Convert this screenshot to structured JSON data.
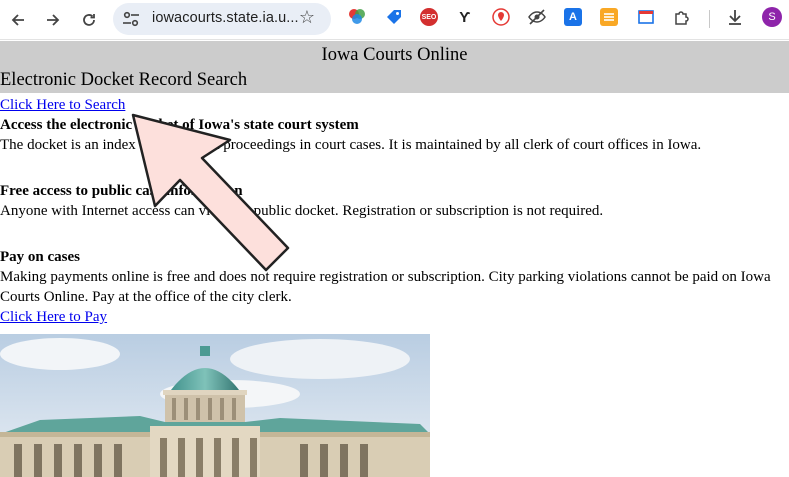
{
  "browser": {
    "url": "iowacourts.state.ia.u...",
    "avatar_initial": "S",
    "extensions": [
      "color-wheel-icon",
      "tag-icon",
      "seo-icon",
      "y-icon",
      "map-pin-icon",
      "eye-slash-icon",
      "translate-icon",
      "note-icon",
      "window-icon",
      "puzzle-icon"
    ],
    "seo_label": "SEO"
  },
  "page": {
    "site_title": "Iowa Courts Online",
    "subtitle": "Electronic Docket Record Search",
    "search_link": "Click Here to Search",
    "sections": [
      {
        "heading": "Access the electronic docket of Iowa's state court system",
        "body": "The docket is an index of filings and proceedings in court cases. It is maintained by all clerk of court offices in Iowa."
      },
      {
        "heading": "Free access to public case information",
        "body": "Anyone with Internet access can view the public docket. Registration or subscription is not required."
      },
      {
        "heading": "Pay on cases",
        "body": "Making payments online is free and does not require registration or subscription. City parking violations cannot be paid on Iowa Courts Online. Pay at the office of the city clerk."
      }
    ],
    "pay_link": "Click Here to Pay"
  },
  "colors": {
    "header_band": "#cccccc",
    "link": "#0000ee",
    "arrow_fill": "#fde0dc",
    "arrow_stroke": "#222222"
  }
}
